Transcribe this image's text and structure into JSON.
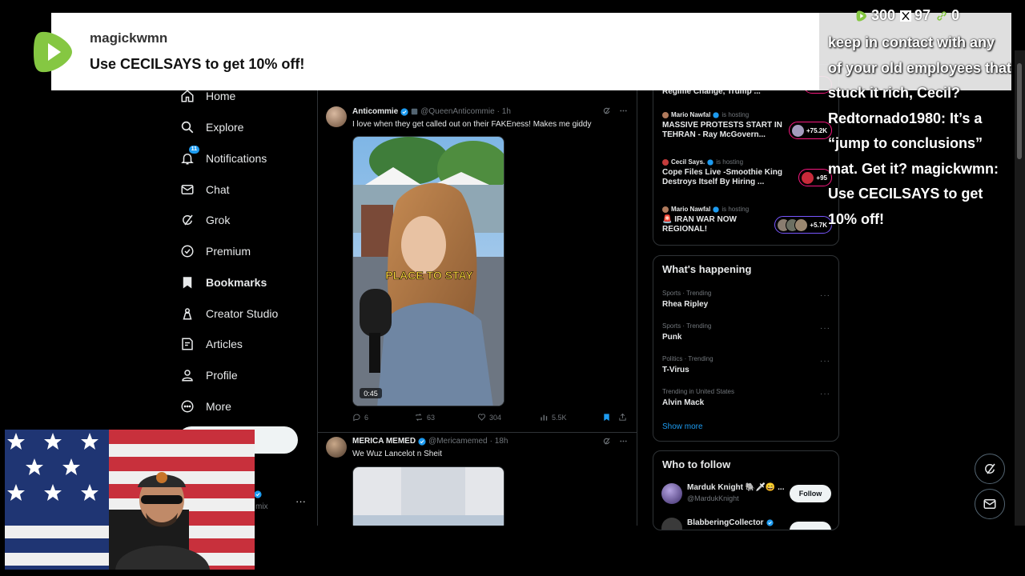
{
  "nav": {
    "items": [
      {
        "label": "Home",
        "icon": "home-icon"
      },
      {
        "label": "Explore",
        "icon": "search-icon"
      },
      {
        "label": "Notifications",
        "icon": "bell-icon",
        "badge": "11"
      },
      {
        "label": "Chat",
        "icon": "mail-icon"
      },
      {
        "label": "Grok",
        "icon": "grok-icon"
      },
      {
        "label": "Premium",
        "icon": "premium-icon"
      },
      {
        "label": "Bookmarks",
        "icon": "bookmark-icon"
      },
      {
        "label": "Creator Studio",
        "icon": "creator-studio-icon"
      },
      {
        "label": "Articles",
        "icon": "articles-icon"
      },
      {
        "label": "Profile",
        "icon": "person-icon"
      },
      {
        "label": "More",
        "icon": "more-circle-icon"
      }
    ],
    "account_handle_fragment": "mix",
    "account_more": "···"
  },
  "feed": {
    "tweets": [
      {
        "name": "Anticommie",
        "handle": "@QueenAnticommie",
        "time": "· 1h",
        "text": "I love when they get called out on their FAKEness! Makes me giddy",
        "media_caption": "PLACE TO STAY",
        "media_duration": "0:45",
        "replies": "6",
        "reposts": "63",
        "likes": "304",
        "views": "5.5K"
      },
      {
        "name": "MERICA MEMED",
        "handle": "@Mericamemed",
        "time": "· 18h",
        "text": "We Wuz Lancelot n Sheit"
      }
    ]
  },
  "spaces": [
    {
      "host": "",
      "title": "Regime Change, Trump ...",
      "count": ""
    },
    {
      "host": "Mario Nawfal",
      "status": "is hosting",
      "title": "MASSIVE PROTESTS START IN TEHRAN - Ray McGovern...",
      "count": "+75.2K"
    },
    {
      "host": "Cecil Says.",
      "status": "is hosting",
      "title": "Cope Files Live -Smoothie King Destroys Itself By Hiring ...",
      "count": "+95"
    },
    {
      "host": "Mario Nawfal",
      "status": "is hosting",
      "title": "🚨 IRAN WAR NOW REGIONAL!",
      "count": "+5.7K"
    }
  ],
  "whats_happening": {
    "title": "What's happening",
    "trends": [
      {
        "category": "Sports · Trending",
        "name": "Rhea Ripley"
      },
      {
        "category": "Sports · Trending",
        "name": "Punk"
      },
      {
        "category": "Politics · Trending",
        "name": "T-Virus"
      },
      {
        "category": "Trending in United States",
        "name": "Alvin Mack"
      }
    ],
    "more_glyph": "···",
    "show_more": "Show more"
  },
  "who_to_follow": {
    "title": "Who to follow",
    "users": [
      {
        "name": "Marduk Knight 🐘🗡😄 ...",
        "handle": "@MardukKnight",
        "button": "Follow"
      },
      {
        "name": "BlabberingCollector",
        "handle": "",
        "button": ""
      }
    ]
  },
  "overlay": {
    "banner_user": "magickwmn",
    "banner_message": "Use CECILSAYS to get 10% off!",
    "stats": {
      "rumble": "300",
      "x": "97",
      "link": "0"
    },
    "chat_text": "keep in contact with any of your old employees that stuck it rich, Cecil? Redtornado1980: It’s a “jump to conclusions” mat. Get it? magickwmn: Use CECILSAYS to get 10% off!"
  },
  "colors": {
    "accent": "#1d9bf0",
    "live_pink": "#f91880",
    "rumble_green": "#85c742",
    "background": "#000000"
  }
}
